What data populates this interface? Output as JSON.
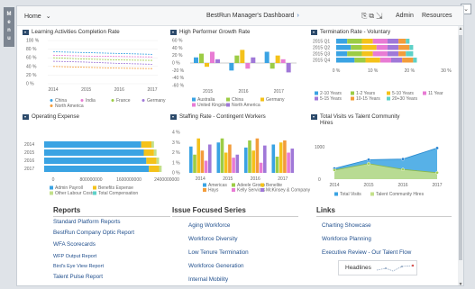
{
  "menu_tab": [
    "M",
    "e",
    "n",
    "u"
  ],
  "header": {
    "home": "Home",
    "title": "BestRun Manager's Dashboard",
    "admin": "Admin",
    "resources": "Resources"
  },
  "tiles": {
    "learning": {
      "title": "Learning Activities Completion Rate",
      "legend": [
        "China",
        "India",
        "France",
        "Germany",
        "North America"
      ]
    },
    "growth": {
      "title": "High Performer Growth Rate",
      "legend": [
        "Australia",
        "China",
        "Germany",
        "United Kingdom",
        "North America"
      ]
    },
    "termination": {
      "title": "Termination Rate - Voluntary",
      "legend": [
        "2-10 Years",
        "1-2 Years",
        "5-10 Years",
        "11 Year",
        "5-15 Years",
        "10-15 Years",
        "20+30 Years"
      ]
    },
    "opex": {
      "title": "Operating Expense",
      "legend": [
        "Admin Payroll",
        "Benefits Expense",
        "Other Labour Costs",
        "Total Compensation"
      ]
    },
    "staffing": {
      "title": "Staffing Rate - Contingent Workers",
      "legend": [
        "Americas",
        "Adeele Group",
        "Benelite",
        "Hays",
        "Kelly Services",
        "McKinsey & Company"
      ]
    },
    "visits": {
      "title_line1": "Total Visits vs Talent Community",
      "title_line2": "Hires",
      "legend": [
        "Total Visits",
        "Talent Community Hires"
      ]
    }
  },
  "chart_data": [
    {
      "type": "line",
      "title": "Learning Activities Completion Rate",
      "x": [
        "2014",
        "2015",
        "2016",
        "2017"
      ],
      "ylim": [
        0,
        100
      ],
      "yticks": [
        "100 %",
        "80 %",
        "60 %",
        "40 %",
        "20 %",
        "0 %"
      ],
      "series": [
        {
          "name": "China",
          "values": [
            74,
            72,
            70,
            68
          ]
        },
        {
          "name": "India",
          "values": [
            66,
            64,
            63,
            62
          ]
        },
        {
          "name": "France",
          "values": [
            60,
            57,
            55,
            54
          ]
        },
        {
          "name": "Germany",
          "values": [
            52,
            50,
            47,
            45
          ]
        },
        {
          "name": "North America",
          "values": [
            40,
            38,
            36,
            35
          ]
        }
      ]
    },
    {
      "type": "bar",
      "title": "High Performer Growth Rate",
      "categories": [
        "2015",
        "2016",
        "2017"
      ],
      "yticks": [
        "60 %",
        "40 %",
        "20 %",
        "0 %",
        "-20 %",
        "-40 %",
        "-60 %"
      ],
      "ylim": [
        -60,
        60
      ],
      "series": [
        {
          "name": "Australia",
          "values": [
            15,
            -20,
            30
          ]
        },
        {
          "name": "China",
          "values": [
            25,
            20,
            -15
          ]
        },
        {
          "name": "Germany",
          "values": [
            -10,
            35,
            20
          ]
        },
        {
          "name": "United Kingdom",
          "values": [
            30,
            -15,
            10
          ]
        },
        {
          "name": "North America",
          "values": [
            10,
            15,
            -25
          ]
        }
      ]
    },
    {
      "type": "bar",
      "orientation": "horizontal-stacked",
      "title": "Termination Rate - Voluntary",
      "categories": [
        "2015 Q1",
        "2015 Q2",
        "2015 Q3",
        "2015 Q4"
      ],
      "xticks": [
        "0 %",
        "10 %",
        "20 %",
        "30 %"
      ],
      "ylim": [
        0,
        30
      ],
      "series": [
        {
          "name": "2-10 Years",
          "values": [
            3,
            4,
            3,
            5
          ]
        },
        {
          "name": "1-2 Years",
          "values": [
            4,
            3,
            4,
            3
          ]
        },
        {
          "name": "5-10 Years",
          "values": [
            3,
            4,
            3,
            4
          ]
        },
        {
          "name": "11 Year",
          "values": [
            4,
            3,
            4,
            3
          ]
        },
        {
          "name": "5-15 Years",
          "values": [
            3,
            3,
            3,
            3
          ]
        },
        {
          "name": "10-15 Years",
          "values": [
            2,
            3,
            2,
            3
          ]
        },
        {
          "name": "20+30 Years",
          "values": [
            1,
            1,
            2,
            1
          ]
        }
      ]
    },
    {
      "type": "bar",
      "orientation": "horizontal-stacked",
      "title": "Operating Expense",
      "categories": [
        "2014",
        "2015",
        "2016",
        "2017"
      ],
      "xticks": [
        "0",
        "800000000",
        "1600000000",
        "2400000000"
      ],
      "ylim": [
        0,
        2400000000
      ],
      "series": [
        {
          "name": "Admin Payroll",
          "values": [
            1900000000,
            1950000000,
            2000000000,
            2050000000
          ]
        },
        {
          "name": "Benefits Expense",
          "values": [
            200000000,
            200000000,
            200000000,
            200000000
          ]
        },
        {
          "name": "Other Labour Costs",
          "values": [
            50000000,
            50000000,
            50000000,
            50000000
          ]
        },
        {
          "name": "Total Compensation",
          "values": [
            0,
            0,
            0,
            0
          ]
        }
      ]
    },
    {
      "type": "bar",
      "title": "Staffing Rate - Contingent Workers",
      "categories": [
        "2014",
        "2015",
        "2016",
        "2017"
      ],
      "yticks": [
        "4 %",
        "3 %",
        "2 %",
        "1 %",
        "0 %"
      ],
      "ylim": [
        0,
        4
      ],
      "series": [
        {
          "name": "Americas",
          "values": [
            2.6,
            3.0,
            2.5,
            2.8
          ]
        },
        {
          "name": "Adeele Group",
          "values": [
            1.8,
            3.4,
            3.2,
            1.6
          ]
        },
        {
          "name": "Benelite",
          "values": [
            3.4,
            2.0,
            2.2,
            3.0
          ]
        },
        {
          "name": "Hays",
          "values": [
            2.2,
            2.8,
            3.4,
            3.2
          ]
        },
        {
          "name": "Kelly Services",
          "values": [
            1.2,
            1.5,
            1.0,
            2.0
          ]
        },
        {
          "name": "McKinsey & Company",
          "values": [
            2.8,
            1.8,
            2.7,
            2.4
          ]
        }
      ]
    },
    {
      "type": "area",
      "title": "Total Visits vs Talent Community Hires",
      "x": [
        "2014",
        "2015",
        "2016",
        "2017"
      ],
      "yticks": [
        "1000",
        "0"
      ],
      "ylim": [
        0,
        1000
      ],
      "series": [
        {
          "name": "Total Visits",
          "values": [
            330,
            600,
            620,
            960
          ]
        },
        {
          "name": "Talent Community Hires",
          "values": [
            280,
            480,
            300,
            200
          ]
        }
      ]
    }
  ],
  "reports": {
    "title": "Reports",
    "links": [
      "Standard Platform Reports",
      "BestRun Company Optic Report",
      "WFA Scorecards",
      "WFP Output Report",
      "Bird's Eye View Report",
      "Talent Pulse Report"
    ]
  },
  "issues": {
    "title": "Issue Focused Series",
    "links": [
      "Aging Workforce",
      "Workforce Diversity",
      "Low Tenure Termination",
      "Workforce Generation",
      "Internal Mobility"
    ]
  },
  "links_section": {
    "title": "Links",
    "links": [
      "Charting Showcase",
      "Workforce Planning",
      "Executive Review - Our Talent Flow"
    ]
  },
  "headlines": {
    "label": "Headlines"
  },
  "colors": {
    "blue": "#3aa3e3",
    "green": "#9ccc45",
    "yellow": "#f4c21a",
    "pink": "#e87bd4",
    "purple": "#a078d8",
    "orange": "#f39c3a",
    "navy": "#1f4e8c",
    "lightgreen": "#c3e08a",
    "teal": "#5dd1c8",
    "gray": "#9aa4ad"
  }
}
